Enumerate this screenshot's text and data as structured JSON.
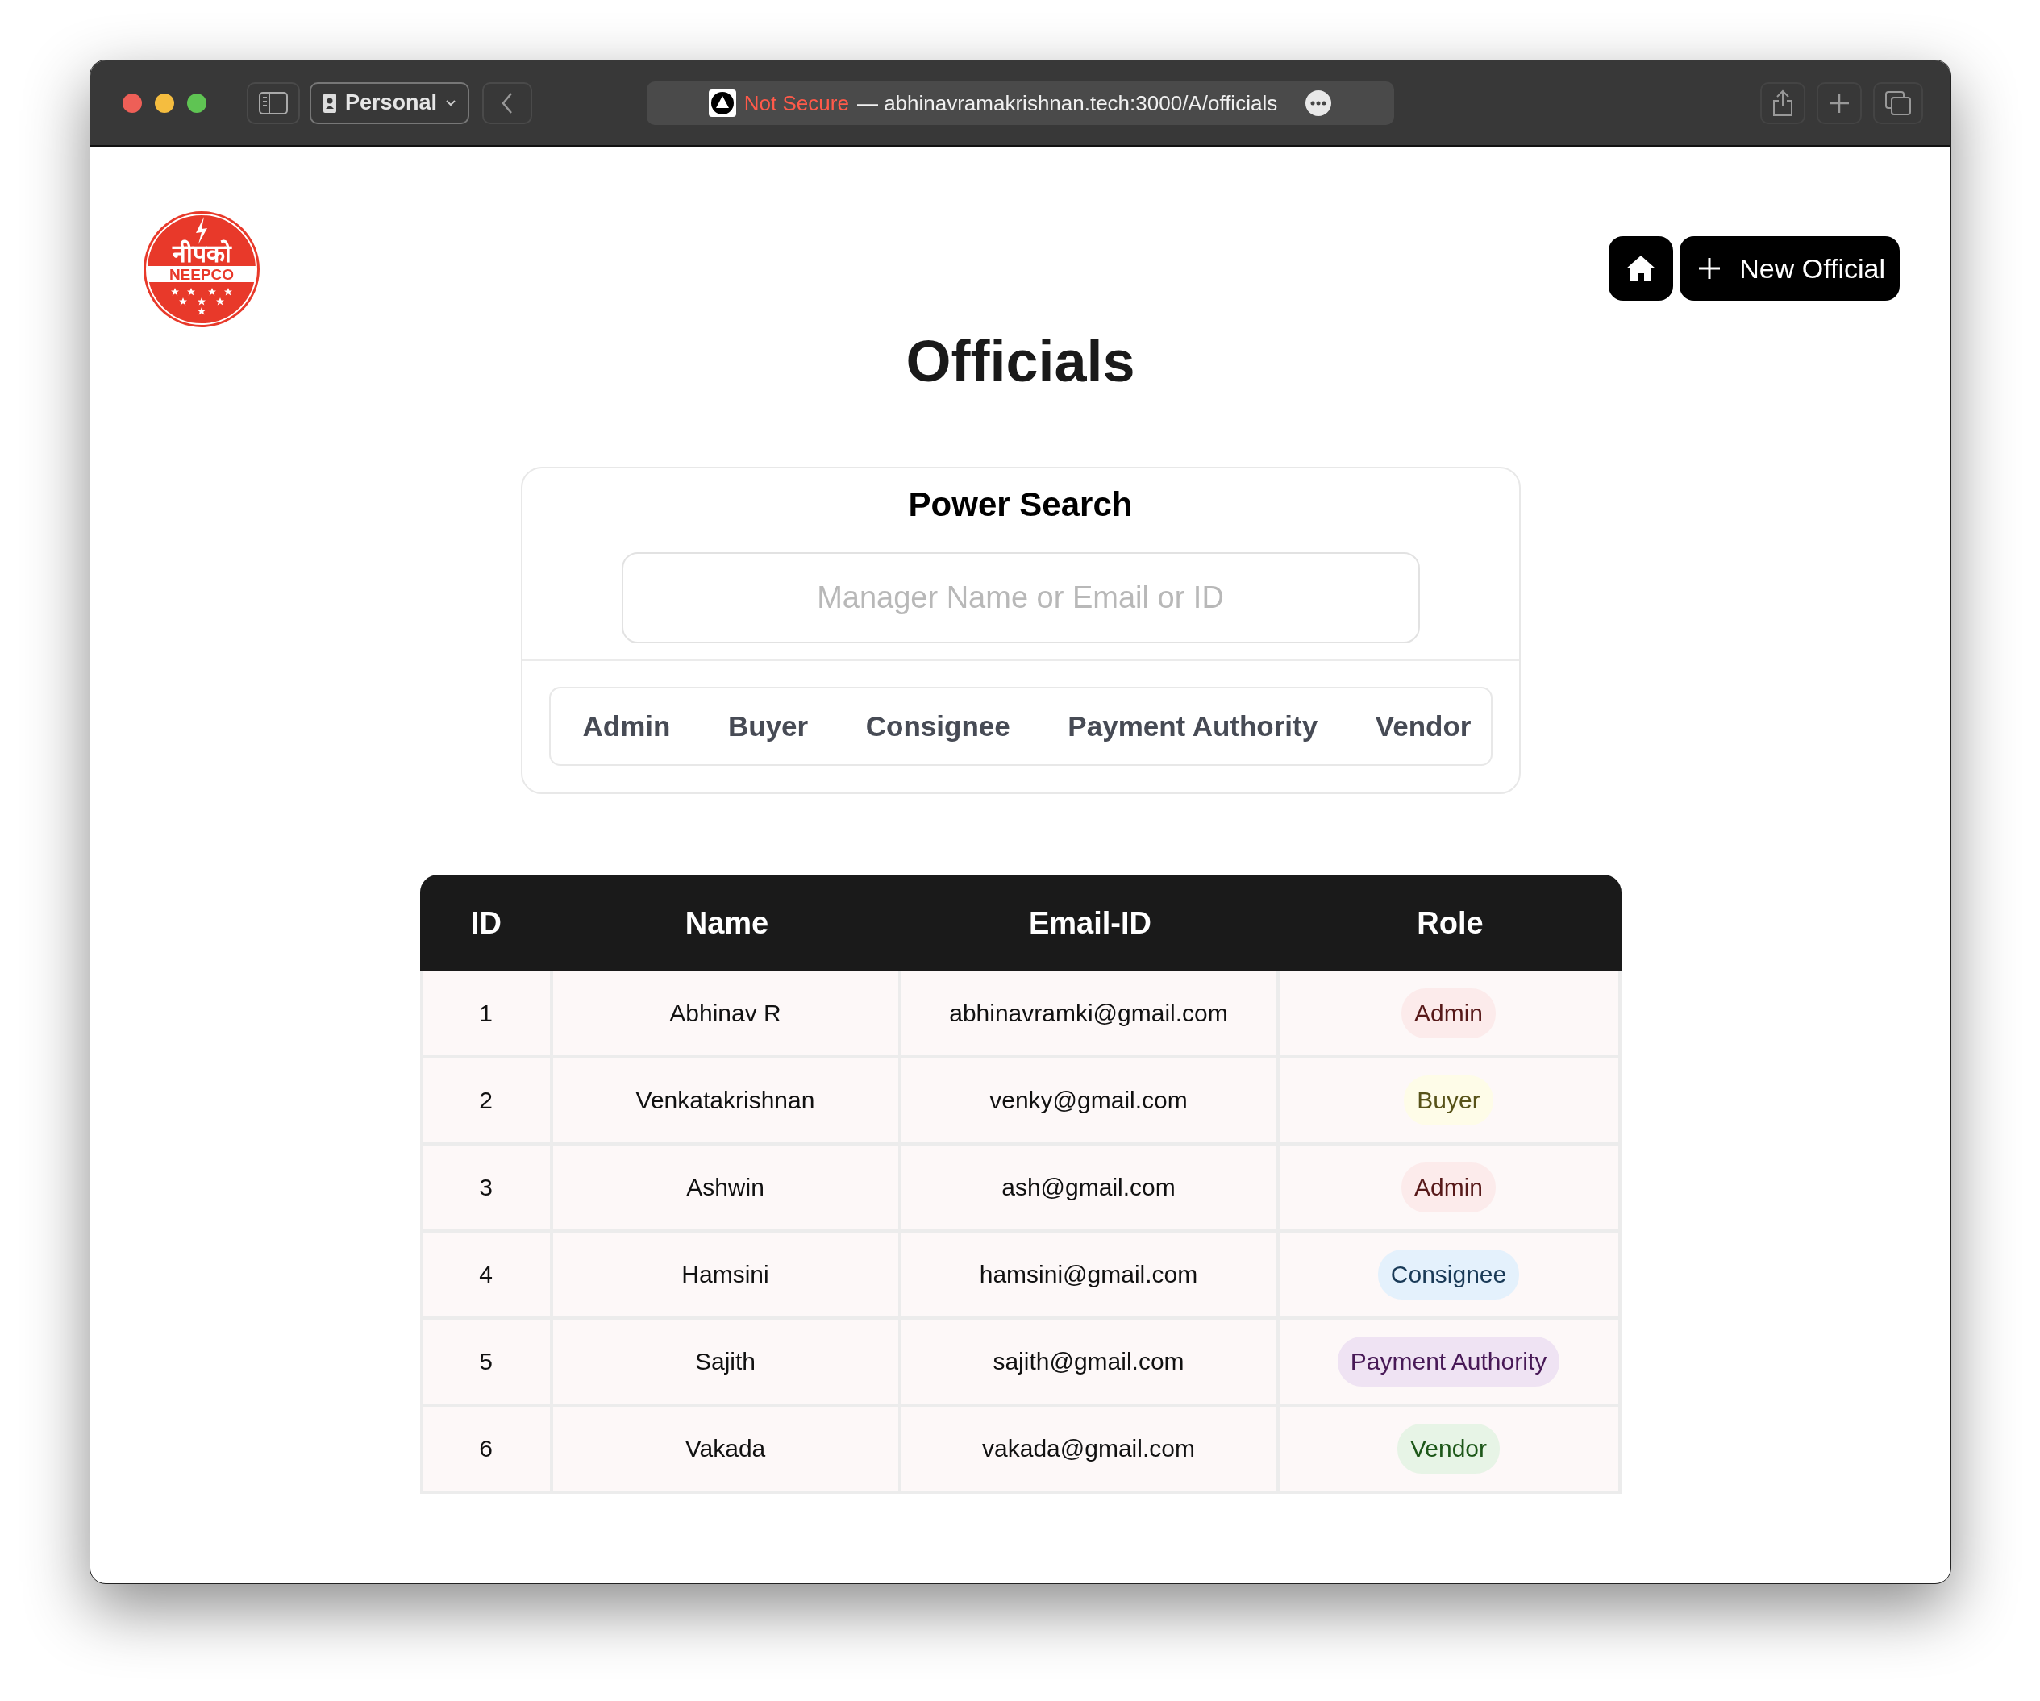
{
  "browser": {
    "profile": "Personal",
    "url_warning": "Not Secure",
    "url": "— abhinavramakrishnan.tech:3000/A/officials"
  },
  "logo": {
    "hindi": "नीपको",
    "english": "NEEPCO"
  },
  "header": {
    "new_button": "New Official"
  },
  "title": "Officials",
  "search": {
    "title": "Power Search",
    "placeholder": "Manager Name or Email or ID",
    "filters": [
      {
        "label": "Admin",
        "selected": false
      },
      {
        "label": "Buyer",
        "selected": false
      },
      {
        "label": "Consignee",
        "selected": false
      },
      {
        "label": "Payment Authority",
        "selected": false
      },
      {
        "label": "Vendor",
        "selected": false
      }
    ]
  },
  "table": {
    "columns": [
      "ID",
      "Name",
      "Email-ID",
      "Role"
    ],
    "rows": [
      {
        "id": "1",
        "name": "Abhinav R",
        "email": "abhinavramki@gmail.com",
        "role": "Admin",
        "color": "#fcebeb"
      },
      {
        "id": "2",
        "name": "Venkatakrishnan",
        "email": "venky@gmail.com",
        "role": "Buyer",
        "color": "#fefce8"
      },
      {
        "id": "3",
        "name": "Ashwin",
        "email": "ash@gmail.com",
        "role": "Admin",
        "color": "#fcebeb"
      },
      {
        "id": "4",
        "name": "Hamsini",
        "email": "hamsini@gmail.com",
        "role": "Consignee",
        "color": "#e4f1fc"
      },
      {
        "id": "5",
        "name": "Sajith",
        "email": "sajith@gmail.com",
        "role": "Payment Authority",
        "color": "#efe3f3"
      },
      {
        "id": "6",
        "name": "Vakada",
        "email": "vakada@gmail.com",
        "role": "Vendor",
        "color": "#e7f4e6"
      }
    ]
  }
}
